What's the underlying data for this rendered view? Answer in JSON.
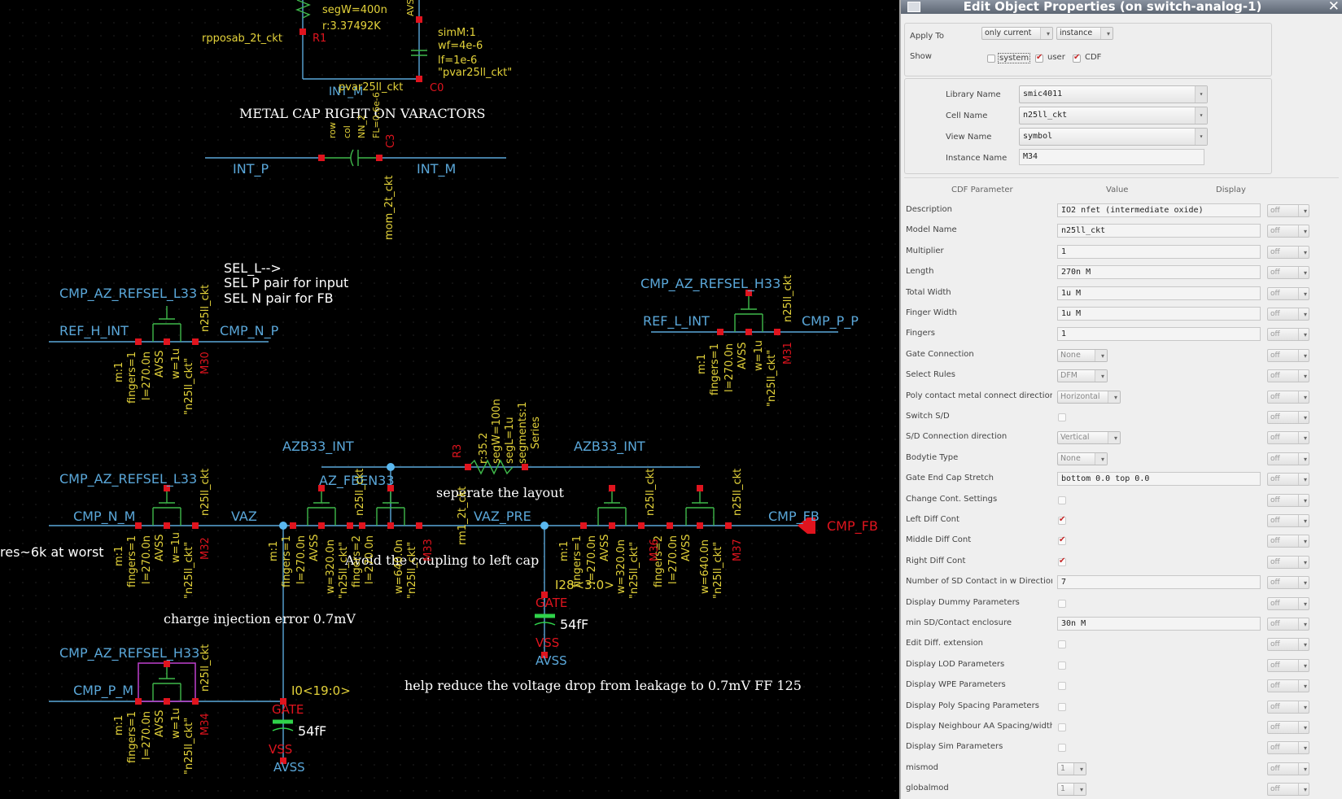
{
  "schematic": {
    "annotations": {
      "metal_cap": "METAL CAP RIGHT ON VARACTORS",
      "sel_line1": "SEL_L-->",
      "sel_line2": "SEL P pair for input",
      "sel_line3": "SEL N pair for FB",
      "separate": "seperate the layout",
      "avoid": "Avoid the coupling to left cap",
      "res_note": "res~6k at worst",
      "charge_inj": "charge injection error 0.7mV",
      "help_reduce": "help reduce the voltage drop from leakage to 0.7mV FF 125"
    },
    "top_res": {
      "segw": "segW=400n",
      "r": "r:3.37492K",
      "cell": "rpposab_2t_ckt",
      "inst": "R1"
    },
    "varactor": {
      "simm": "simM:1",
      "wf": "wf=4e-6",
      "lf": "lf=1e-6",
      "model": "\"pvar25ll_ckt\"",
      "cell": "pvar25ll_ckt",
      "inst": "C0",
      "avss": "AVS",
      "int_m": "INT_M"
    },
    "mom": {
      "int_p": "INT_P",
      "int_m": "INT_M",
      "cell": "mom_2t_ckt",
      "inst": "C3",
      "p1": "row",
      "p2": "col",
      "p3": "NN_2",
      "p4": "FL=0.6e-6"
    },
    "nets": {
      "cmp_az_refsel_l33_top": "CMP_AZ_REFSEL_L33",
      "ref_h_int": "REF_H_INT",
      "cmp_n_p": "CMP_N_P",
      "cmp_az_refsel_h33_top": "CMP_AZ_REFSEL_H33",
      "ref_l_int": "REF_L_INT",
      "cmp_p_p": "CMP_P_P",
      "azb33_int_l": "AZB33_INT",
      "azb33_int_r": "AZB33_INT",
      "az_fben33": "AZ_FBEN33",
      "cmp_az_refsel_l33_mid": "CMP_AZ_REFSEL_L33",
      "cmp_n_m": "CMP_N_M",
      "vaz": "VAZ",
      "vaz_pre": "VAZ_PRE",
      "cmp_fb": "CMP_FB",
      "cmp_fb_pin": "CMP_FB",
      "cmp_az_refsel_h33_bot": "CMP_AZ_REFSEL_H33",
      "cmp_p_m": "CMP_P_M"
    },
    "transistors": {
      "m30": {
        "inst": "M30",
        "m": "m:1",
        "fingers": "fingers=1",
        "l": "l=270.0n",
        "avss": "AVSS",
        "w": "w=1u",
        "model": "\"n25ll_ckt\"",
        "cell": "n25ll_ckt"
      },
      "m31": {
        "inst": "M31",
        "m": "m:1",
        "fingers": "fingers=1",
        "l": "l=270.0n",
        "avss": "AVSS",
        "w": "w=1u",
        "model": "\"n25ll_ckt\"",
        "cell": "n25ll_ckt"
      },
      "m32": {
        "inst": "M32",
        "m": "m:1",
        "fingers": "fingers=1",
        "l": "l=270.0n",
        "avss": "AVSS",
        "w": "w=1u",
        "model": "\"n25ll_ckt\"",
        "cell": "n25ll_ckt"
      },
      "m33": {
        "inst": "M33",
        "m": "m:1",
        "fingers": "fingers=1",
        "l": "l=270.0n",
        "avss": "AVSS",
        "w": "w=320.0n",
        "model": "\"n25ll_ckt\"",
        "cell": "n25ll_ckt",
        "w2": "w=640.0n",
        "model2": "\"n25ll_ckt\"",
        "f2": "fingers=2",
        "l2": "l=270.0n"
      },
      "m34": {
        "inst": "M34",
        "m": "m:1",
        "fingers": "fingers=1",
        "l": "l=270.0n",
        "avss": "AVSS",
        "w": "w=1u",
        "model": "\"n25ll_ckt\"",
        "cell": "n25ll_ckt"
      },
      "m37": {
        "inst": "M37",
        "m": "m:1",
        "fingers": "fingers=1",
        "l": "l=270.0n",
        "avss": "AVSS",
        "w": "w=320.0n",
        "model": "\"n25ll_ckt\"",
        "cell": "n25ll_ckt",
        "w2": "w=640.0n",
        "model2": "\"n25ll_ckt\"",
        "f2": "fingers=2",
        "l2": "l=270.0n",
        "m2": "M36"
      }
    },
    "resistor_r3": {
      "inst": "R3",
      "r": "r:35.2",
      "segw": "segW=100n",
      "segl": "segL=1u",
      "segments": "segments:1",
      "series": "Series",
      "cell": "rm1_2t_ckt"
    },
    "caps": {
      "c1": {
        "bus": "I28<3:0>",
        "gate": "GATE",
        "val": "54fF",
        "vss": "VSS",
        "avss": "AVSS"
      },
      "c2": {
        "bus": "I0<19:0>",
        "gate": "GATE",
        "val": "54fF",
        "vss": "VSS",
        "avss": "AVSS"
      }
    }
  },
  "dialog": {
    "title": "Edit Object Properties (on switch-analog-1)",
    "apply_to_label": "Apply To",
    "apply_to_value": "only current",
    "apply_to_scope": "instance",
    "show_label": "Show",
    "show_system": "system",
    "show_user": "user",
    "show_cdf": "CDF",
    "library_label": "Library Name",
    "library_value": "smic4011",
    "cell_label": "Cell Name",
    "cell_value": "n25ll_ckt",
    "view_label": "View Name",
    "view_value": "symbol",
    "instance_label": "Instance Name",
    "instance_value": "M34",
    "col_param": "CDF Parameter",
    "col_value": "Value",
    "col_display": "Display",
    "display_value": "off",
    "params": [
      {
        "label": "Description",
        "type": "text",
        "value": "IO2 nfet (intermediate oxide)"
      },
      {
        "label": "Model Name",
        "type": "text",
        "value": "n25ll_ckt"
      },
      {
        "label": "Multiplier",
        "type": "text",
        "value": "1"
      },
      {
        "label": "Length",
        "type": "text",
        "value": "270n M"
      },
      {
        "label": "Total Width",
        "type": "text",
        "value": "1u M"
      },
      {
        "label": "Finger Width",
        "type": "text",
        "value": "1u M"
      },
      {
        "label": "Fingers",
        "type": "text",
        "value": "1"
      },
      {
        "label": "Gate Connection",
        "type": "combo",
        "value": "None"
      },
      {
        "label": "Select Rules",
        "type": "combo",
        "value": "DFM"
      },
      {
        "label": "Poly contact metal connect direction",
        "type": "combo",
        "value": "Horizontal"
      },
      {
        "label": "Switch S/D",
        "type": "check",
        "value": ""
      },
      {
        "label": "S/D Connection direction",
        "type": "combo",
        "value": "Vertical"
      },
      {
        "label": "Bodytie Type",
        "type": "combo",
        "value": "None"
      },
      {
        "label": "Gate End Cap Stretch",
        "type": "text",
        "value": "bottom 0.0 top 0.0"
      },
      {
        "label": "Change Cont. Settings",
        "type": "check",
        "value": ""
      },
      {
        "label": "Left Diff Cont",
        "type": "check",
        "value": "on"
      },
      {
        "label": "Middle Diff Cont",
        "type": "check",
        "value": "on"
      },
      {
        "label": "Right Diff Cont",
        "type": "check",
        "value": "on"
      },
      {
        "label": "Number of SD Contact in w Direction",
        "type": "text",
        "value": "7"
      },
      {
        "label": "Display Dummy Parameters",
        "type": "check",
        "value": ""
      },
      {
        "label": "min SD/Contact enclosure",
        "type": "text",
        "value": "30n M"
      },
      {
        "label": "Edit Diff. extension",
        "type": "check",
        "value": ""
      },
      {
        "label": "Display LOD Parameters",
        "type": "check",
        "value": ""
      },
      {
        "label": "Display WPE Parameters",
        "type": "check",
        "value": ""
      },
      {
        "label": "Display Poly Spacing Parameters",
        "type": "check",
        "value": ""
      },
      {
        "label": "Display Neighbour AA Spacing/width Pa",
        "type": "check",
        "value": ""
      },
      {
        "label": "Display Sim Parameters",
        "type": "check",
        "value": ""
      },
      {
        "label": "mismod",
        "type": "combo",
        "value": "1"
      },
      {
        "label": "globalmod",
        "type": "combo",
        "value": "1"
      }
    ]
  }
}
